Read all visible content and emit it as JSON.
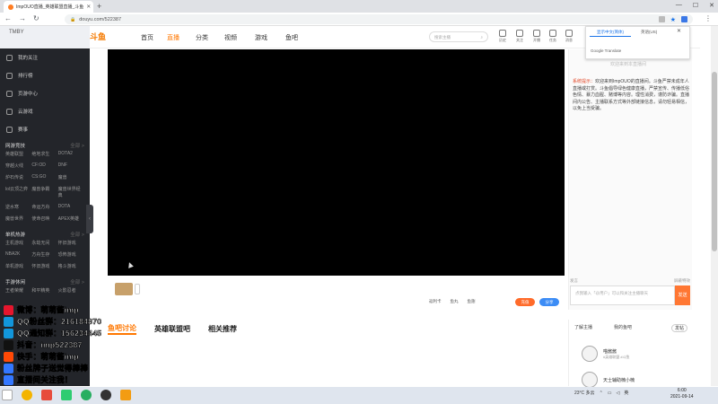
{
  "browser": {
    "tab_title": "ImpOUO直播_英雄联盟直播_斗鱼",
    "url": "douyu.com/522387"
  },
  "sidebar": {
    "logo_text": "TMBY",
    "items": [
      {
        "label": "我的关注"
      },
      {
        "label": "排行榜"
      },
      {
        "label": "页游中心"
      },
      {
        "label": "云游戏"
      },
      {
        "label": "赛事"
      }
    ],
    "categories": [
      {
        "title": "网游竞技",
        "more": "全部 >",
        "games": [
          "英雄联盟",
          "绝地求生",
          "DOTA2",
          "穿越火线",
          "CF:OD",
          "DNF",
          "炉石传说",
          "CS:GO",
          "魔兽",
          "lol云顶之弈",
          "魔兽争霸",
          "魔兽世界经典",
          "逆水寒",
          "命运方舟",
          "DOTA",
          "魔兽世界",
          "使命召唤",
          "APEX英雄"
        ]
      },
      {
        "title": "单机热游",
        "more": "全部 >",
        "games": [
          "主机游戏",
          "永劫无间",
          "怀旧游戏",
          "NBA2K",
          "方舟生存",
          "恐怖游戏",
          "单机游戏",
          "怀旧游戏",
          "格斗游戏"
        ]
      },
      {
        "title": "手游休闲",
        "more": "全部 >",
        "games": [
          "王者荣耀",
          "和平精英",
          "火影忍者"
        ]
      }
    ]
  },
  "header": {
    "logo": "斗鱼",
    "nav": [
      "首页",
      "直播",
      "分类",
      "视频",
      "游戏",
      "鱼吧"
    ],
    "search_placeholder": "搜索主播",
    "icons": [
      "历史",
      "关注",
      "开播",
      "任务",
      "消息",
      "鱼粮",
      "关注"
    ]
  },
  "player": {
    "controls": [
      "返利卡",
      "鱼丸",
      "鱼翅"
    ],
    "orange_btn": "充值",
    "blue_btn": "分享"
  },
  "subtabs": [
    "鱼吧讨论",
    "英雄联盟吧",
    "相关推荐"
  ],
  "chat": {
    "header_note": "欢迎来到本直播间",
    "system_tag": "系统提示：",
    "system_msg": "欢迎来到ImpOUO的直播间。斗鱼严禁未成年人直播或打赏。斗鱼倡导绿色健康直播，严禁宣传、传播低俗色情、暴力血腥、赌博等内容。理性消费，谨防诈骗。直播间内公告、主播联系方式等外部链接信息，请勿轻易相信，以免上当受骗。",
    "filter_left": "发言",
    "filter_right": "屏蔽特效",
    "input_placeholder": "点我输入「@用户」可以和关注主播聊天",
    "send": "发送"
  },
  "rank": {
    "tabs": [
      "了解主播",
      "我的鱼吧",
      "发帖"
    ],
    "rows": [
      {
        "name": "喵酱酱",
        "desc": "#英雄联盟 #斗鱼"
      },
      {
        "name": "天士辅助楠小楠",
        "desc": ""
      }
    ]
  },
  "translate": {
    "tab1": "显示中文(简体)",
    "tab2": "英语(US)",
    "footer": "Google Translate"
  },
  "overlay": [
    {
      "text": "微博：萌萌酱imp",
      "color": "#e6162d"
    },
    {
      "text": "QQ粉丝群：216184870",
      "color": "#1296db"
    },
    {
      "text": "QQ通知群：156234445",
      "color": "#1296db"
    },
    {
      "text": "抖音：imp522387",
      "color": "#111111"
    },
    {
      "text": "快手：萌萌酱imp",
      "color": "#ff4906"
    },
    {
      "text": "粉丝牌子送觉得棒棒",
      "color": "#3377ff"
    },
    {
      "text": "直播间关注我！",
      "color": "#3377ff"
    }
  ],
  "taskbar": {
    "weather": "23°C 多云",
    "time": "6:00",
    "date": "2021-09-14",
    "lang": "英"
  },
  "colors": {
    "accent": "#ff7700",
    "sidebar_bg": "#23252a",
    "player_bg": "#000000"
  }
}
